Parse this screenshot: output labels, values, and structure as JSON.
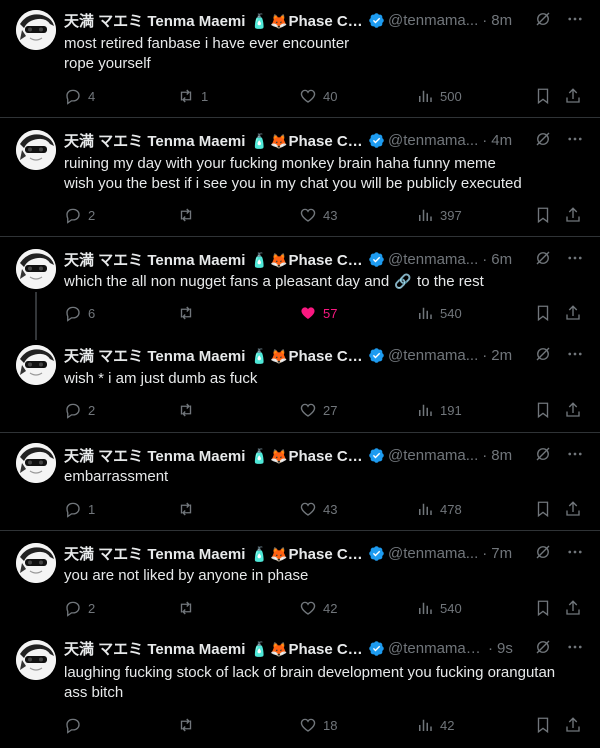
{
  "colors": {
    "background": "#000000",
    "text": "#e7e9ea",
    "muted": "#71767b",
    "divider": "#2f3336",
    "like": "#f91880",
    "verified": "#1d9bf0"
  },
  "author": {
    "name_jp": "天満 マエミ Tenma Maemi",
    "emoji_1": "🧴",
    "emoji_2": "🦊",
    "name_suffix_short": "Phase Co...",
    "name_suffix_long": "Phase Con...",
    "handle_short": "@tenmama...",
    "handle_long": "@tenmamae..."
  },
  "tweets": [
    {
      "time": "8m",
      "lines": [
        "most retired fanbase i have ever encounter",
        "rope yourself"
      ],
      "replies": "4",
      "retweets": "1",
      "likes": "40",
      "views": "500"
    },
    {
      "time": "4m",
      "lines": [
        "ruining my day with your fucking monkey  brain haha funny meme",
        "wish you the best if i see you in my chat you will be publicly executed"
      ],
      "replies": "2",
      "retweets": "",
      "likes": "43",
      "views": "397"
    },
    {
      "time": "6m",
      "lines": [
        "which the all non nugget fans a pleasant day and",
        "to the rest"
      ],
      "chain_emoji": "🔗",
      "replies": "6",
      "retweets": "",
      "likes": "57",
      "views": "540"
    },
    {
      "time": "2m",
      "lines": [
        "wish * i am just dumb as fuck"
      ],
      "replies": "2",
      "retweets": "",
      "likes": "27",
      "views": "191"
    },
    {
      "time": "8m",
      "lines": [
        "embarrassment"
      ],
      "replies": "1",
      "retweets": "",
      "likes": "43",
      "views": "478"
    },
    {
      "time": "7m",
      "lines": [
        "you are not liked by anyone in phase"
      ],
      "replies": "2",
      "retweets": "",
      "likes": "42",
      "views": "540"
    },
    {
      "time": "9s",
      "lines": [
        "laughing fucking stock of lack of brain development you fucking orangutan",
        "ass bitch"
      ],
      "replies": "",
      "retweets": "",
      "likes": "18",
      "views": "42"
    }
  ]
}
